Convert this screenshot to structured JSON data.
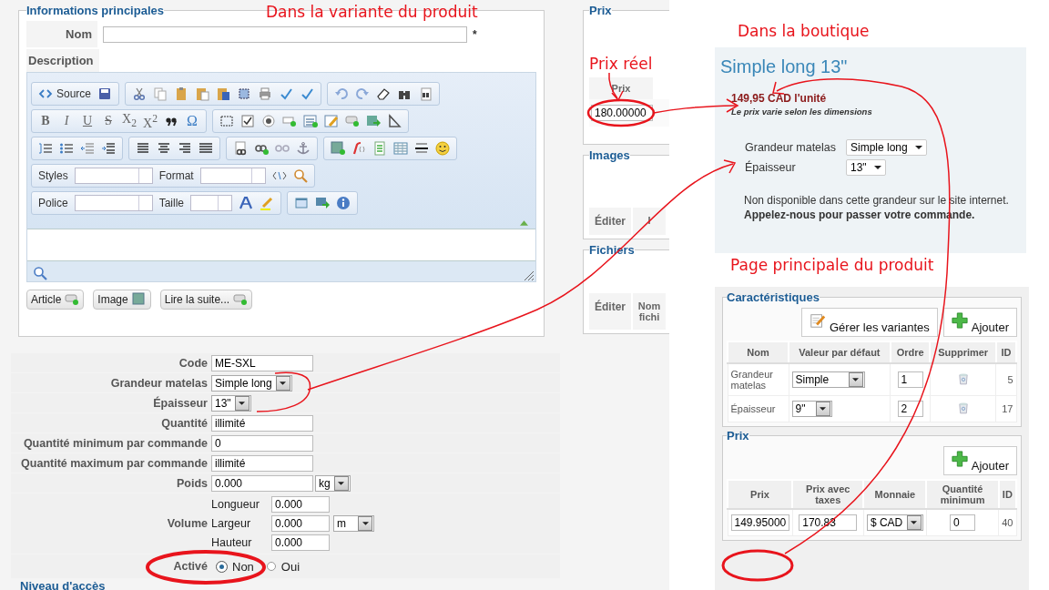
{
  "annotations": [
    {
      "text": "Dans la variante du produit"
    },
    {
      "text": "Prix réel"
    },
    {
      "text": "Dans la boutique"
    },
    {
      "text": "Page principale du produit"
    }
  ],
  "variant_form": {
    "legend": "Informations principales",
    "name_label": "Nom",
    "required_mark": "*",
    "description_label": "Description",
    "editor": {
      "source_label": "Source",
      "format_glyphs": [
        "B",
        "I",
        "U",
        "S",
        "X$_{2}$",
        "X$^{2}$"
      ],
      "symbol_glyph": "Ω",
      "combos": [
        {
          "label": "Styles"
        },
        {
          "label": "Format"
        },
        {
          "label": "Police"
        },
        {
          "label": "Taille"
        }
      ]
    },
    "insert_buttons": [
      {
        "label": "Article"
      },
      {
        "label": "Image"
      },
      {
        "label": "Lire la suite..."
      }
    ]
  },
  "fields": [
    {
      "kind": "text",
      "label": "Code",
      "value": "ME-SXL"
    },
    {
      "kind": "select",
      "label": "Grandeur matelas",
      "value": "Simple long"
    },
    {
      "kind": "select",
      "label": "Épaisseur",
      "value": "13\""
    },
    {
      "kind": "text",
      "label": "Quantité",
      "value": "illimité"
    },
    {
      "kind": "text",
      "label": "Quantité minimum par commande",
      "value": "0"
    },
    {
      "kind": "text",
      "label": "Quantité maximum par commande",
      "value": "illimité"
    },
    {
      "kind": "unit",
      "label": "Poids",
      "value": "0.000",
      "unit": "kg"
    },
    {
      "kind": "volume",
      "label": "Volume",
      "unit": "m",
      "dims": [
        {
          "label": "Longueur",
          "value": "0.000"
        },
        {
          "label": "Largeur",
          "value": "0.000"
        },
        {
          "label": "Hauteur",
          "value": "0.000"
        }
      ]
    },
    {
      "kind": "radio",
      "label": "Activé",
      "options": [
        {
          "label": "Non",
          "selected": true
        },
        {
          "label": "Oui",
          "selected": false
        }
      ]
    }
  ],
  "next_section": "Niveau d'accès",
  "side_panels": [
    {
      "kind": "price",
      "legend": "Prix",
      "column": "Prix",
      "value": "180.00000"
    },
    {
      "kind": "list",
      "legend": "Images",
      "columns": [
        "Éditer",
        "I"
      ]
    },
    {
      "kind": "list",
      "legend": "Fichiers",
      "columns": [
        "Éditer",
        "Nom fichi"
      ]
    }
  ],
  "shop": {
    "title": "Simple long 13\"",
    "price": "149,95 CAD l'unité",
    "price_note": "Le prix varie selon les dimensions",
    "options": [
      {
        "label": "Grandeur matelas",
        "value": "Simple long"
      },
      {
        "label": "Épaisseur",
        "value": "13\""
      }
    ],
    "notice": "Non disponible dans cette grandeur sur le site internet.",
    "call_to_action": "Appelez-nous pour passer votre commande."
  },
  "characteristics": {
    "legend": "Caractéristiques",
    "buttons": [
      {
        "kind": "manage",
        "label": "Gérer les variantes"
      },
      {
        "kind": "add",
        "label": "Ajouter"
      }
    ],
    "columns": [
      "Nom",
      "Valeur par défaut",
      "Ordre",
      "Supprimer",
      "ID"
    ],
    "rows": [
      {
        "name": "Grandeur matelas",
        "default": "Simple",
        "order": "1",
        "id": "5"
      },
      {
        "name": "Épaisseur",
        "default": "9\"",
        "order": "2",
        "id": "17"
      }
    ]
  },
  "prices": {
    "legend": "Prix",
    "button": {
      "kind": "add",
      "label": "Ajouter"
    },
    "columns": [
      "Prix",
      "Prix avec taxes",
      "Monnaie",
      "Quantité minimum",
      "ID"
    ],
    "rows": [
      {
        "price": "149.95000",
        "price_with_tax": "170.83",
        "currency": "$ CAD",
        "min_quantity": "0",
        "id": "40"
      }
    ]
  }
}
